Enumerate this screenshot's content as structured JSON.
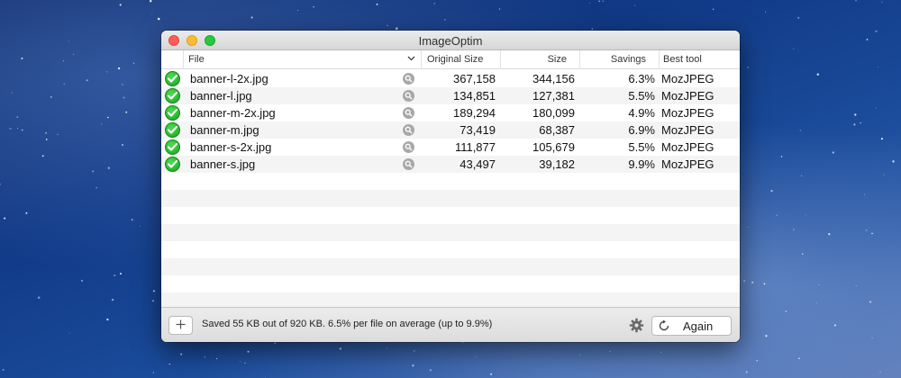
{
  "window": {
    "title": "ImageOptim"
  },
  "columns": {
    "file": "File",
    "original_size": "Original Size",
    "size": "Size",
    "savings": "Savings",
    "best_tool": "Best tool"
  },
  "files": [
    {
      "name": "banner-l-2x.jpg",
      "original_size": "367,158",
      "size": "344,156",
      "savings": "6.3%",
      "tool": "MozJPEG"
    },
    {
      "name": "banner-l.jpg",
      "original_size": "134,851",
      "size": "127,381",
      "savings": "5.5%",
      "tool": "MozJPEG"
    },
    {
      "name": "banner-m-2x.jpg",
      "original_size": "189,294",
      "size": "180,099",
      "savings": "4.9%",
      "tool": "MozJPEG"
    },
    {
      "name": "banner-m.jpg",
      "original_size": "73,419",
      "size": "68,387",
      "savings": "6.9%",
      "tool": "MozJPEG"
    },
    {
      "name": "banner-s-2x.jpg",
      "original_size": "111,877",
      "size": "105,679",
      "savings": "5.5%",
      "tool": "MozJPEG"
    },
    {
      "name": "banner-s.jpg",
      "original_size": "43,497",
      "size": "39,182",
      "savings": "9.9%",
      "tool": "MozJPEG"
    }
  ],
  "status": {
    "summary": "Saved 55 KB out of 920 KB. 6.5% per file on average (up to 9.9%)"
  },
  "toolbar": {
    "again_label": "Again"
  },
  "icons": {
    "status": "check-circle-icon",
    "preview": "magnifier-icon",
    "add": "plus-icon",
    "settings": "gear-icon",
    "again": "refresh-icon",
    "sort": "chevron-down-icon"
  },
  "colors": {
    "close": "#fc5f57",
    "minimize": "#fdbc2e",
    "zoom": "#29c841",
    "success": "#1fb324"
  }
}
